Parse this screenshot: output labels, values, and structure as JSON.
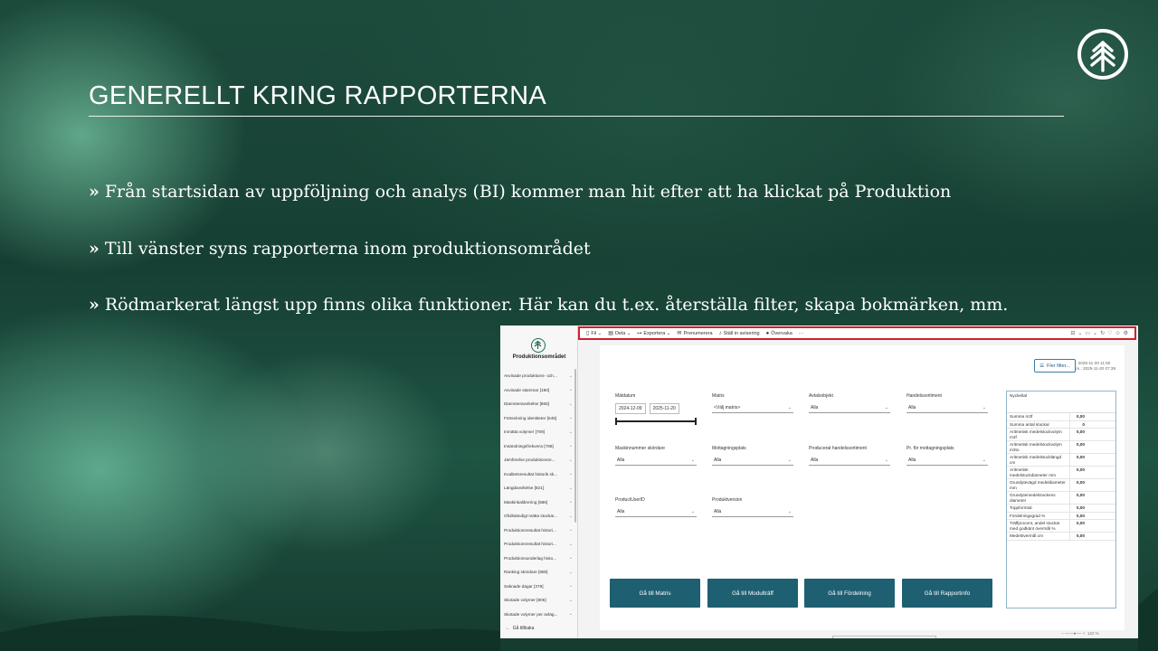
{
  "slide": {
    "title": "GENERELLT KRING RAPPORTERNA",
    "bullets": [
      "Från startsidan av uppföljning och analys (BI) kommer man hit efter att ha klickat på Produktion",
      "Till vänster syns rapporterna inom produktionsområdet",
      "Rödmarkerat längst upp finns olika funktioner. Här kan du t.ex. återställa filter, skapa bokmärken, mm."
    ],
    "bullet_marker": "»",
    "logo_icon": "tree-logo-icon",
    "colors": {
      "background": "#1c4b3c",
      "text": "#ffffff",
      "highlight": "#d0202a",
      "button": "#1f5f72"
    }
  },
  "app": {
    "toolbar": {
      "file": "Fil",
      "share": "Dela",
      "export": "Exportera",
      "subscribe": "Prenumerera",
      "alert": "Ställ in avisering",
      "monitor": "Övervaka",
      "more": "···"
    },
    "sidebar": {
      "title": "Produktionsområdet",
      "items": [
        "Avvisade produktions- och...",
        "Avvisade stammar [190]",
        "Diameteravvikelse [865]",
        "Förteckning identiteter [645]",
        "Inmätta volymer [709]",
        "Insändningsfrekvens [788]",
        "Jämförelse produktionsre...",
        "Kvalitetsresultat historik sk...",
        "Längdavvikelse [821]",
        "Maskinkalibrering [586]",
        "Ofullständigt mätta stockar...",
        "Produktionsresultat histori...",
        "Produktionsresultat histori...",
        "Produktionsunderlag histo...",
        "Ranking skördare [880]",
        "Saknade dagar [379]",
        "Skotade volymer [806]",
        "Skotade volymer per avläg..."
      ],
      "back": "Gå tillbaka"
    },
    "report": {
      "updated_1": "Rapport uppdaterad: 2025-11-20 11:50",
      "updated_2": "Baseras på data t.o.m.: 2025-11-20 07:39",
      "more_filters": "Fler filter...",
      "slicers": {
        "date": {
          "label": "Mätdatum",
          "from": "2024-12-09",
          "to": "2025-11-20"
        },
        "matrix": {
          "label": "Matris",
          "value": "<Välj matris>"
        },
        "object": {
          "label": "Avtalsobjekt",
          "value": "Alla"
        },
        "assortment": {
          "label": "Handelssortiment",
          "value": "Alla"
        },
        "harvester": {
          "label": "Maskinnummer skördare",
          "value": "Alla"
        },
        "reception": {
          "label": "Mottagningsplats",
          "value": "Alla"
        },
        "produced": {
          "label": "Producerat handelssortiment",
          "value": "Alla"
        },
        "pr_reception": {
          "label": "Pr. för mottagningsplats",
          "value": "Alla"
        },
        "user": {
          "label": "ProductUserID",
          "value": "Alla"
        },
        "version": {
          "label": "Produktversion",
          "value": "Alla"
        }
      },
      "kpi": {
        "title": "Nyckeltal",
        "rows": [
          {
            "k": "Summa m3f",
            "v": "0,00"
          },
          {
            "k": "Summa antal stockar",
            "v": "0"
          },
          {
            "k": "Aritmetisk medelstockvolym m3f",
            "v": "0,00"
          },
          {
            "k": "Aritmetisk medelstockvolym m3to",
            "v": "0,00"
          },
          {
            "k": "Aritmetisk medelstocklängd cm",
            "v": "0,00"
          },
          {
            "k": "Aritmetisk medelstockdiameter mm",
            "v": "0,00"
          },
          {
            "k": "Grundytevägd medeldiameter mm",
            "v": "0,00"
          },
          {
            "k": "Grundytemedelstockens diameter",
            "v": "0,00"
          },
          {
            "k": "Toppformtal",
            "v": "0,00"
          },
          {
            "k": "Fördelningsgrad %",
            "v": "0,00"
          },
          {
            "k": "Träffprocent, andel stockar med godkänt övermål %",
            "v": "0,00"
          },
          {
            "k": "Medelövermål cm",
            "v": "0,00"
          }
        ]
      },
      "buttons": [
        "Gå till Matris",
        "Gå till Modulträff",
        "Gå till Fördelning",
        "Gå till Rapportinfo"
      ],
      "zoom": "122 %"
    }
  }
}
